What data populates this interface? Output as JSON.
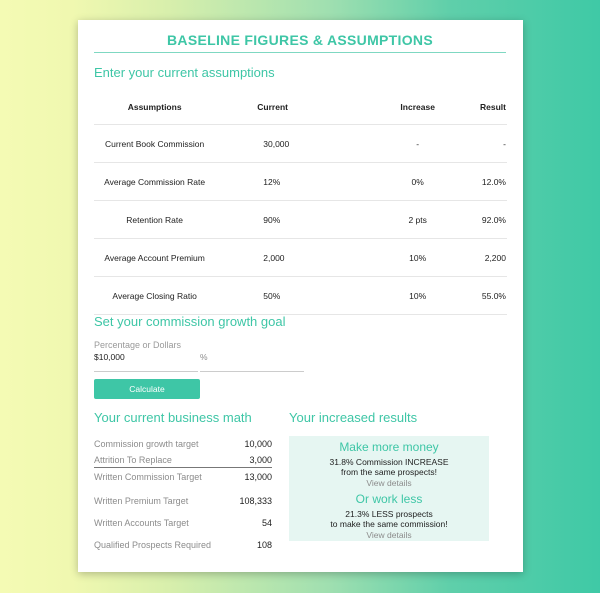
{
  "title": "BASELINE FIGURES & ASSUMPTIONS",
  "assumptions_section": {
    "heading": "Enter your current assumptions",
    "columns": [
      "Assumptions",
      "Current",
      "Increase",
      "Result"
    ],
    "rows": [
      {
        "label": "Current Book Commission",
        "current": "30,000",
        "increase": "-",
        "result": "-"
      },
      {
        "label": "Average Commission Rate",
        "current": "12%",
        "increase": "0%",
        "result": "12.0%"
      },
      {
        "label": "Retention Rate",
        "current": "90%",
        "increase": "2 pts",
        "result": "92.0%"
      },
      {
        "label": "Average Account Premium",
        "current": "2,000",
        "increase": "10%",
        "result": "2,200"
      },
      {
        "label": "Average Closing Ratio",
        "current": "50%",
        "increase": "10%",
        "result": "55.0%"
      }
    ]
  },
  "goal_section": {
    "heading": "Set your commission growth goal",
    "field_label": "Percentage or Dollars",
    "dollar_value": "$10,000",
    "percent_value": "%",
    "calculate_label": "Calculate"
  },
  "business_math": {
    "heading": "Your current business math",
    "rows": [
      {
        "label": "Commission growth target",
        "value": "10,000"
      },
      {
        "label": "Attrition To Replace",
        "value": "3,000"
      },
      {
        "label": "Written Commission Target",
        "value": "13,000"
      },
      {
        "label": "Written Premium Target",
        "value": "108,333"
      },
      {
        "label": "Written Accounts Target",
        "value": "54"
      },
      {
        "label": "Qualified Prospects Required",
        "value": "108"
      }
    ]
  },
  "increased_results": {
    "heading": "Your increased results",
    "more_money": {
      "title": "Make more money",
      "line1": "31.8% Commission INCREASE",
      "line2": "from the same prospects!",
      "link": "View details"
    },
    "less_work": {
      "title": "Or work less",
      "line1": "21.3% LESS prospects",
      "line2": "to make the same commission!",
      "link": "View details"
    }
  },
  "colors": {
    "accent": "#3ec6a6",
    "panel": "#e6f6f2"
  }
}
